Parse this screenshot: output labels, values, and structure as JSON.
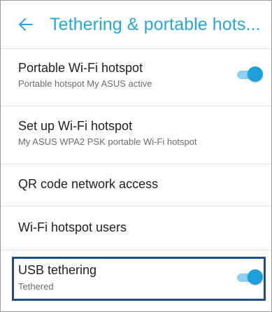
{
  "header": {
    "title": "Tethering & portable hots...",
    "back_icon": "arrow-left-icon"
  },
  "colors": {
    "accent": "#2aa7d2",
    "toggle_on": "#1ea0dc",
    "highlight_border": "#1f4e8c"
  },
  "settings": [
    {
      "label": "Portable Wi-Fi hotspot",
      "summary": "Portable hotspot My ASUS active",
      "toggle": "on"
    },
    {
      "label": "Set up Wi-Fi hotspot",
      "summary": "My ASUS WPA2 PSK portable Wi-Fi hotspot"
    },
    {
      "label": "QR code network access"
    },
    {
      "label": "Wi-Fi hotspot users"
    },
    {
      "label": "USB tethering",
      "summary": "Tethered",
      "toggle": "on"
    }
  ]
}
